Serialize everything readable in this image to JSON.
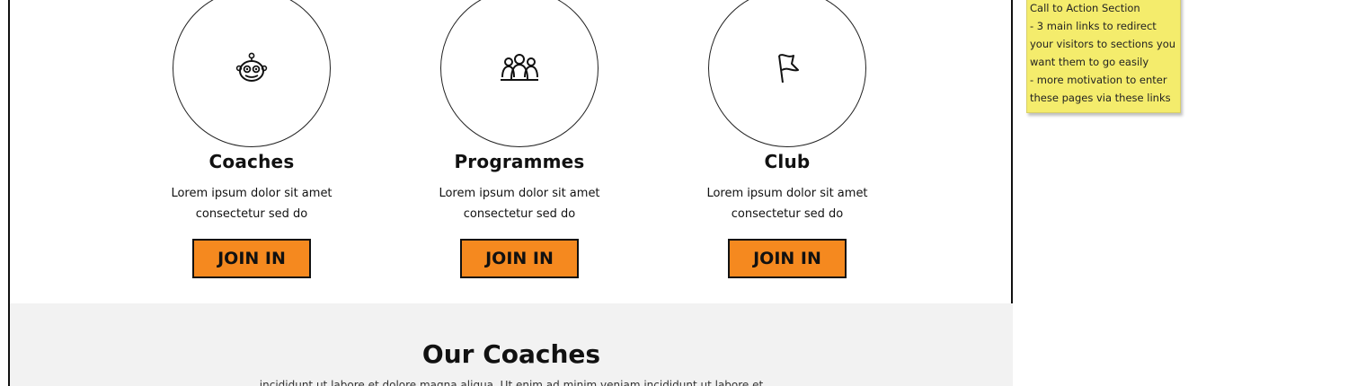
{
  "cta_cards": [
    {
      "icon": "robot-head-icon",
      "title": "Coaches",
      "description_line1": "Lorem ipsum dolor sit amet",
      "description_line2": "consectetur sed do",
      "button_label": "JOIN IN"
    },
    {
      "icon": "group-people-icon",
      "title": "Programmes",
      "description_line1": "Lorem ipsum dolor sit amet",
      "description_line2": "consectetur sed do",
      "button_label": "JOIN IN"
    },
    {
      "icon": "flag-icon",
      "title": "Club",
      "description_line1": "Lorem ipsum dolor sit amet",
      "description_line2": "consectetur sed do",
      "button_label": "JOIN IN"
    }
  ],
  "coaches_section": {
    "heading": "Our Coaches",
    "subtext": "incididunt ut labore et dolore magna aliqua. Ut enim ad minim veniam incididunt ut labore et"
  },
  "sticky_note": {
    "lines": [
      "Call to Action Section",
      "- 3 main links to redirect",
      "your visitors to sections you",
      "want them to go easily",
      "- more motivation to enter",
      "these pages via these links"
    ]
  },
  "colors": {
    "button_fill": "#f5891f",
    "section_bg": "#f2f2f2",
    "sticky_note_bg": "#f4ec6c"
  }
}
